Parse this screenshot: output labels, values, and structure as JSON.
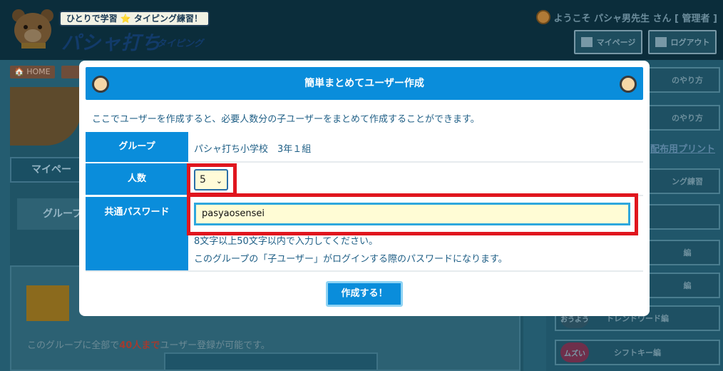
{
  "header": {
    "tagline": "ひとりで学習 ⭐ タイピング練習！",
    "brand": "パシャ打ち",
    "brand_sub": "タイピング",
    "welcome": "ようこそ パシャ男先生 さん [ 管理者 ]",
    "mypage_label": "マイページ",
    "logout_label": "ログアウト"
  },
  "breadcrumb": {
    "home": "🏠 HOME"
  },
  "left": {
    "mypage_label": "マイペー",
    "group_label": "グループ",
    "group_note_prefix": "このグループに全部で",
    "group_note_highlight": "40人まで",
    "group_note_suffix": "ユーザー登録が可能です。"
  },
  "right": {
    "items": [
      {
        "label": "のやり方",
        "badge": ""
      },
      {
        "label": "のやり方",
        "badge": ""
      },
      {
        "label": "ング練習",
        "badge": ""
      },
      {
        "label": "",
        "badge": ""
      },
      {
        "label": "編",
        "badge": ""
      },
      {
        "label": "編",
        "badge": ""
      },
      {
        "label": "トレンドワード編",
        "badge": "おうよう"
      },
      {
        "label": "シフトキー編",
        "badge": "ムズい"
      }
    ],
    "print_link": "配布用プリント"
  },
  "modal": {
    "title": "簡単まとめてユーザー作成",
    "intro": "ここでユーザーを作成すると、必要人数分の子ユーザーをまとめて作成することができます。",
    "group_label": "グループ",
    "group_value": "パシャ打ち小学校　3年１組",
    "count_label": "人数",
    "count_value": "5",
    "password_label": "共通パスワード",
    "password_value": "pasyaosensei",
    "password_hint1": "8文字以上50文字以内で入力してください。",
    "password_hint2": "このグループの「子ユーザー」がログインする際のパスワードになります。",
    "submit_label": "作成する！"
  },
  "colors": {
    "accent": "#0a8ddb",
    "highlight": "#e0161e",
    "input_bg": "#fffcd5"
  }
}
